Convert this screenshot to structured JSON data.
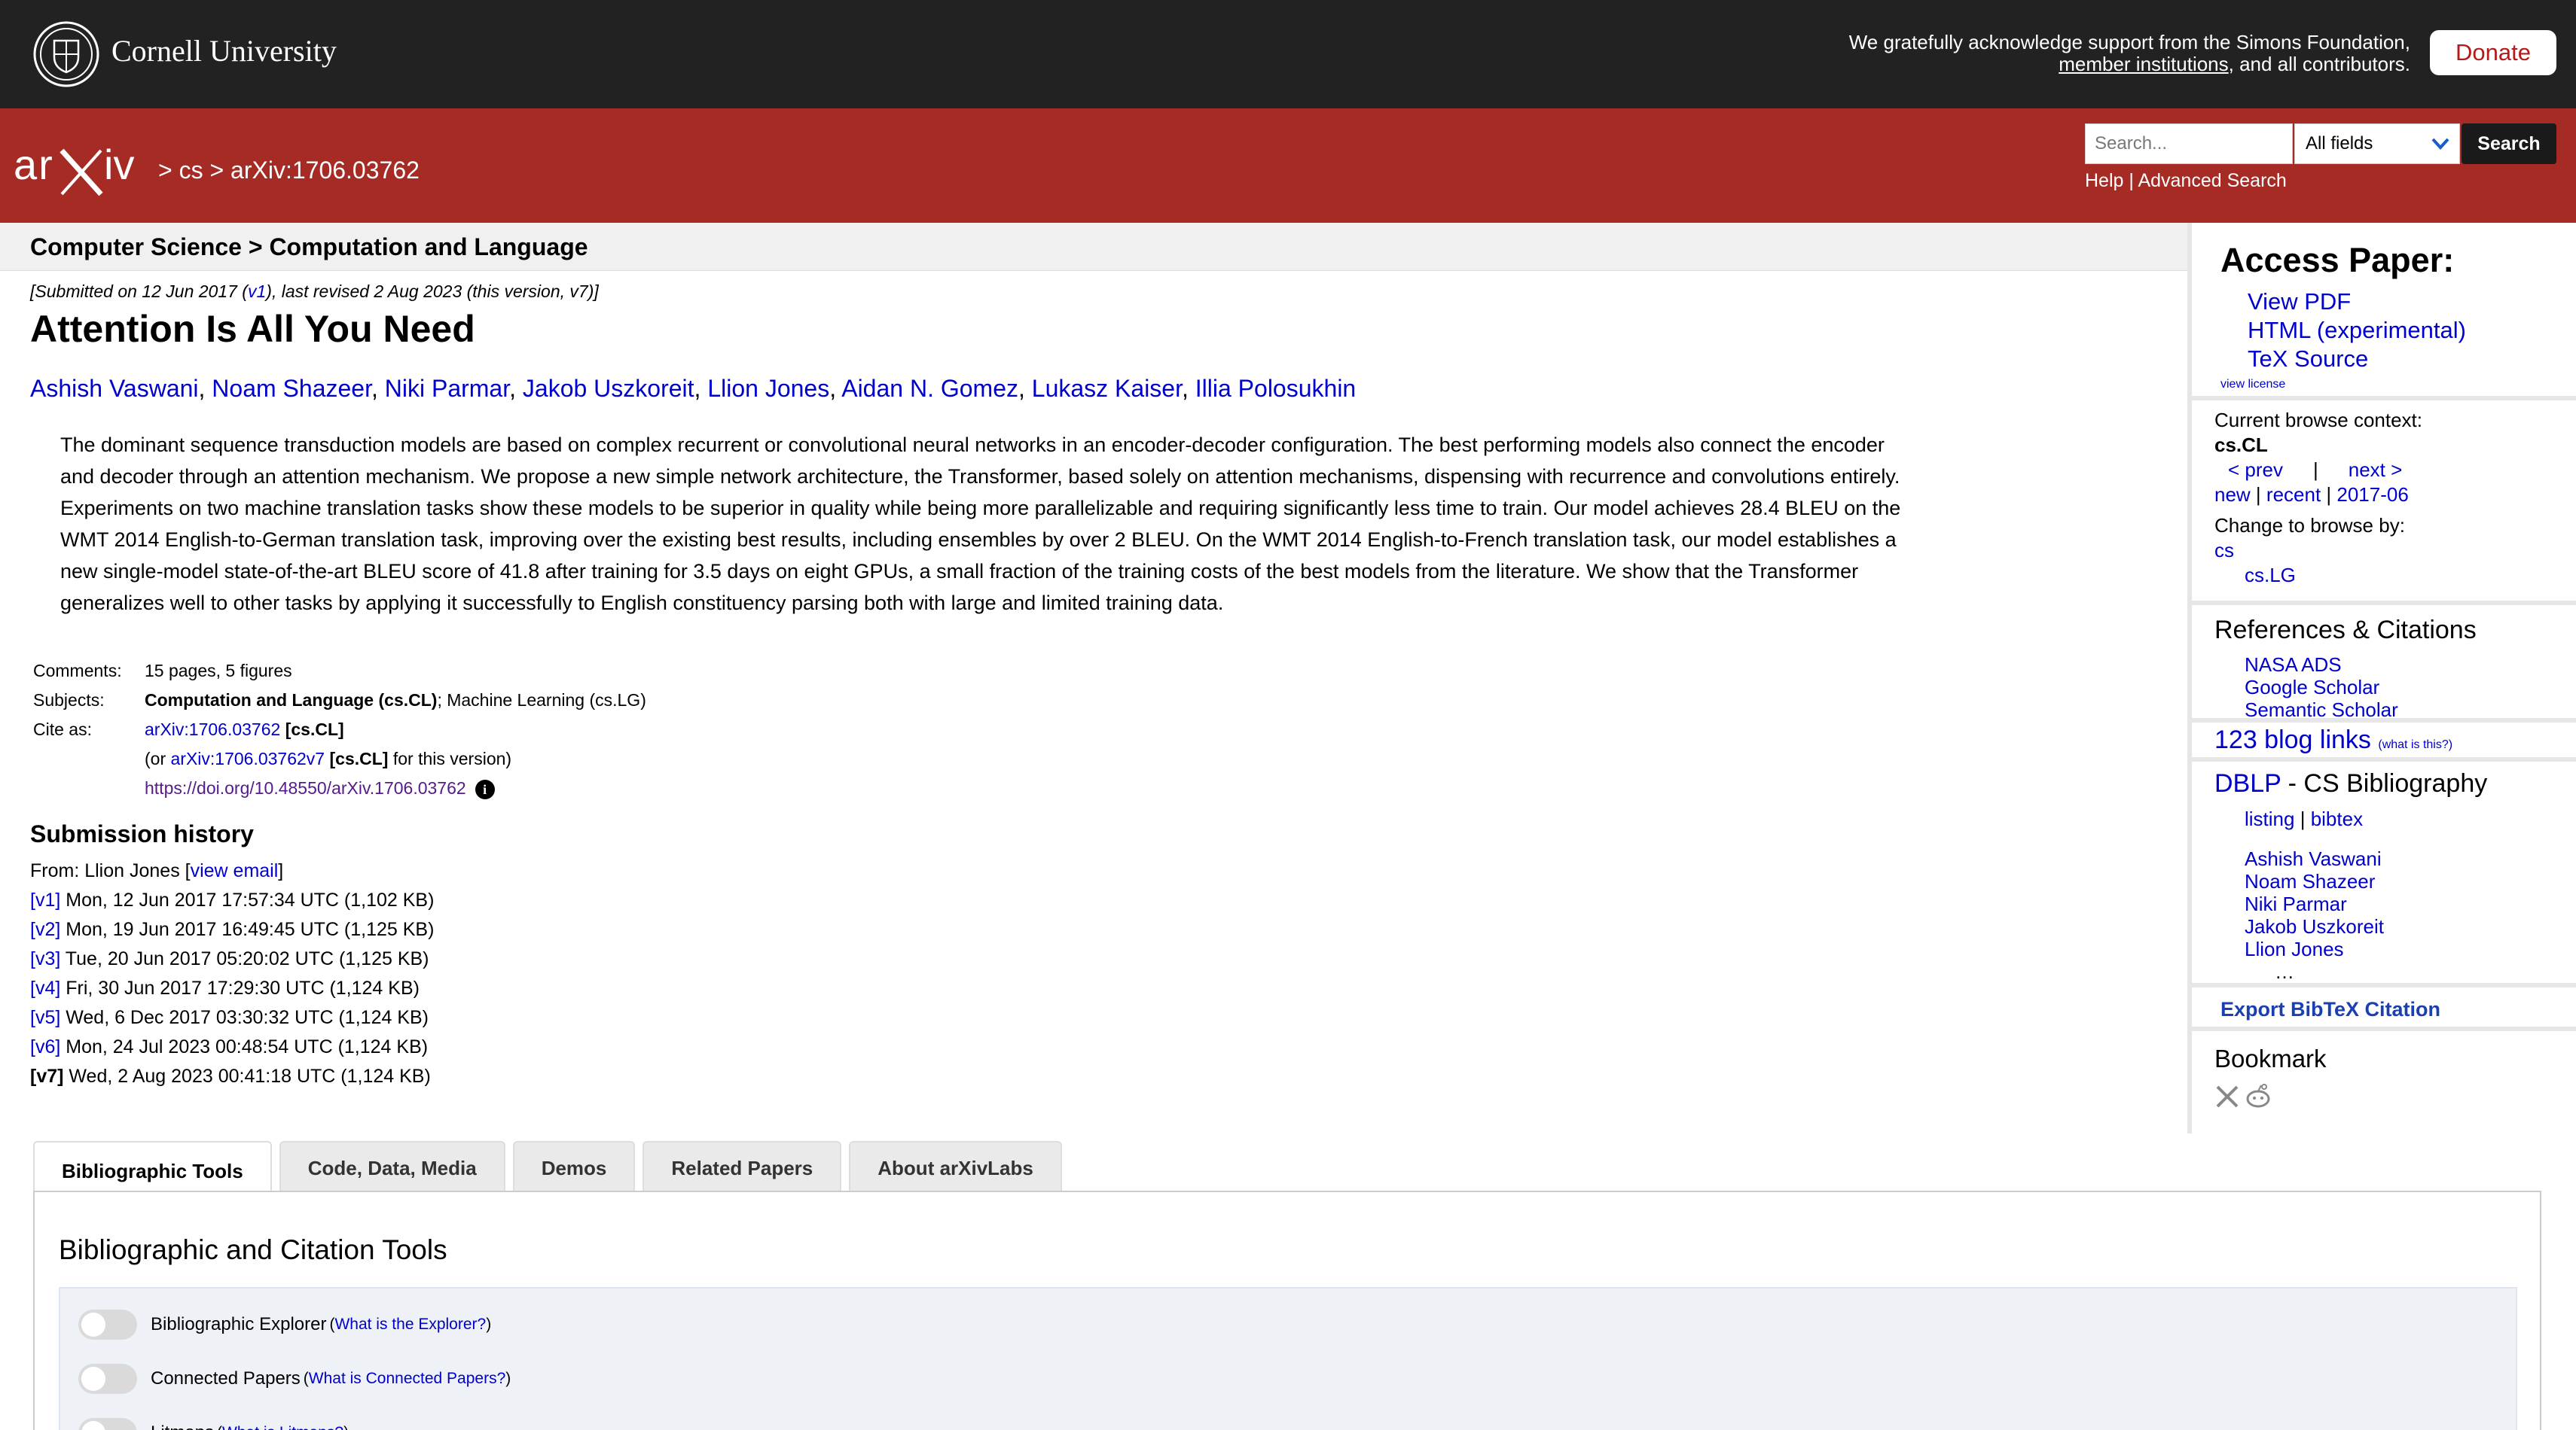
{
  "topbar": {
    "university": "Cornell University",
    "support_line1": "We gratefully acknowledge support from the Simons Foundation,",
    "support_link": "member institutions",
    "support_line2_rest": ", and all contributors.",
    "donate_label": "Donate"
  },
  "header": {
    "logo_text": "arXiv",
    "breadcrumb": "> cs > arXiv:1706.03762",
    "search_placeholder": "Search...",
    "search_field_selected": "All fields",
    "search_button": "Search",
    "help_link": "Help",
    "help_sep": "|",
    "advanced_link": "Advanced Search"
  },
  "subheader": "Computer Science > Computation and Language",
  "paper": {
    "dateline_pre": "[Submitted on 12 Jun 2017 (",
    "dateline_v1": "v1",
    "dateline_post": "), last revised 2 Aug 2023 (this version, v7)]",
    "title": "Attention Is All You Need",
    "authors": [
      "Ashish Vaswani",
      "Noam Shazeer",
      "Niki Parmar",
      "Jakob Uszkoreit",
      "Llion Jones",
      "Aidan N. Gomez",
      "Lukasz Kaiser",
      "Illia Polosukhin"
    ],
    "abstract_lines": [
      "The dominant sequence transduction models are based on complex recurrent or convolutional neural networks in an encoder-decoder configuration. The best performing models also connect the encoder",
      "and decoder through an attention mechanism. We propose a new simple network architecture, the Transformer, based solely on attention mechanisms, dispensing with recurrence and convolutions entirely.",
      "Experiments on two machine translation tasks show these models to be superior in quality while being more parallelizable and requiring significantly less time to train. Our model achieves 28.4 BLEU on the",
      "WMT 2014 English-to-German translation task, improving over the existing best results, including ensembles by over 2 BLEU. On the WMT 2014 English-to-French translation task, our model establishes a",
      "new single-model state-of-the-art BLEU score of 41.8 after training for 3.5 days on eight GPUs, a small fraction of the training costs of the best models from the literature. We show that the Transformer",
      "generalizes well to other tasks by applying it successfully to English constituency parsing both with large and limited training data."
    ]
  },
  "metadata": {
    "comments_label": "Comments:",
    "comments": "15 pages, 5 figures",
    "subjects_label": "Subjects:",
    "subjects_primary": "Computation and Language (cs.CL)",
    "subjects_rest": "; Machine Learning (cs.LG)",
    "cite_label": "Cite as:",
    "cite_id": "arXiv:1706.03762",
    "cite_cat": "[cs.CL]",
    "cite_or": "(or ",
    "cite_v7": "arXiv:1706.03762v7",
    "cite_v7_cat": "[cs.CL]",
    "cite_v7_post": " for this version)",
    "doi": "https://doi.org/10.48550/arXiv.1706.03762",
    "info_icon": "i"
  },
  "history": {
    "title": "Submission history",
    "from_pre": "From: Llion Jones [",
    "view_email": "view email",
    "from_post": "]",
    "versions": [
      {
        "tag": "[v1]",
        "text": " Mon, 12 Jun 2017 17:57:34 UTC (1,102 KB)"
      },
      {
        "tag": "[v2]",
        "text": " Mon, 19 Jun 2017 16:49:45 UTC (1,125 KB)"
      },
      {
        "tag": "[v3]",
        "text": " Tue, 20 Jun 2017 05:20:02 UTC (1,125 KB)"
      },
      {
        "tag": "[v4]",
        "text": " Fri, 30 Jun 2017 17:29:30 UTC (1,124 KB)"
      },
      {
        "tag": "[v5]",
        "text": " Wed, 6 Dec 2017 03:30:32 UTC (1,124 KB)"
      },
      {
        "tag": "[v6]",
        "text": " Mon, 24 Jul 2023 00:48:54 UTC (1,124 KB)"
      },
      {
        "tag": "[v7]",
        "text": " Wed, 2 Aug 2023 00:41:18 UTC (1,124 KB)"
      }
    ]
  },
  "sidebar": {
    "access_title": "Access Paper:",
    "access_links": [
      "View PDF",
      "HTML (experimental)",
      "TeX Source"
    ],
    "view_license": "view license",
    "browse_context_label": "Current browse context:",
    "browse_context": "cs.CL",
    "prev": "< prev",
    "nav_sep": "|",
    "next": "next >",
    "new": "new",
    "recent": "recent",
    "month": "2017-06",
    "change_browse": "Change to browse by:",
    "browse_cs": "cs",
    "browse_cslg": "cs.LG",
    "refs_title": "References & Citations",
    "refs_links": [
      "NASA ADS",
      "Google Scholar",
      "Semantic Scholar"
    ],
    "blog_links": "123 blog links",
    "whats_this": "(what is this?)",
    "dblp": "DBLP",
    "dblp_rest": " - CS Bibliography",
    "listing": "listing",
    "bibtex": "bibtex",
    "dblp_authors": [
      "Ashish Vaswani",
      "Noam Shazeer",
      "Niki Parmar",
      "Jakob Uszkoreit",
      "Llion Jones"
    ],
    "ellipsis": "…",
    "export_bibtex": "Export BibTeX Citation",
    "bookmark": "Bookmark"
  },
  "tabs": [
    "Bibliographic Tools",
    "Code, Data, Media",
    "Demos",
    "Related Papers",
    "About arXivLabs"
  ],
  "panel": {
    "title": "Bibliographic and Citation Tools",
    "tools": [
      {
        "name": "Bibliographic Explorer",
        "help": "What is the Explorer?"
      },
      {
        "name": "Connected Papers",
        "help": "What is Connected Papers?"
      },
      {
        "name": "Litmaps",
        "help": "What is Litmaps?"
      }
    ]
  }
}
